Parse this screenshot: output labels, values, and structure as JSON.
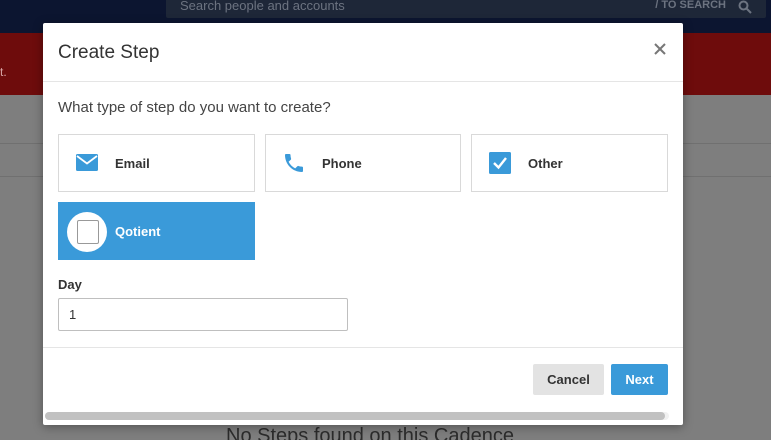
{
  "background": {
    "search_placeholder": "Search people and accounts",
    "search_hint": "/ TO SEARCH",
    "red_banner_text": "t.",
    "empty_state": "No Steps found on this Cadence"
  },
  "modal": {
    "title": "Create Step",
    "question": "What type of step do you want to create?",
    "step_types": [
      {
        "label": "Email",
        "icon": "envelope-icon",
        "selected": false
      },
      {
        "label": "Phone",
        "icon": "phone-icon",
        "selected": false
      },
      {
        "label": "Other",
        "icon": "checkbox-checked-icon",
        "selected": false
      },
      {
        "label": "Qotient",
        "icon": "qotient-checkbox-icon",
        "selected": true
      }
    ],
    "day_label": "Day",
    "day_value": "1",
    "cancel_label": "Cancel",
    "next_label": "Next"
  },
  "colors": {
    "accent": "#3a9ad9",
    "topbar": "#0c1530",
    "banner": "#c0392b"
  }
}
